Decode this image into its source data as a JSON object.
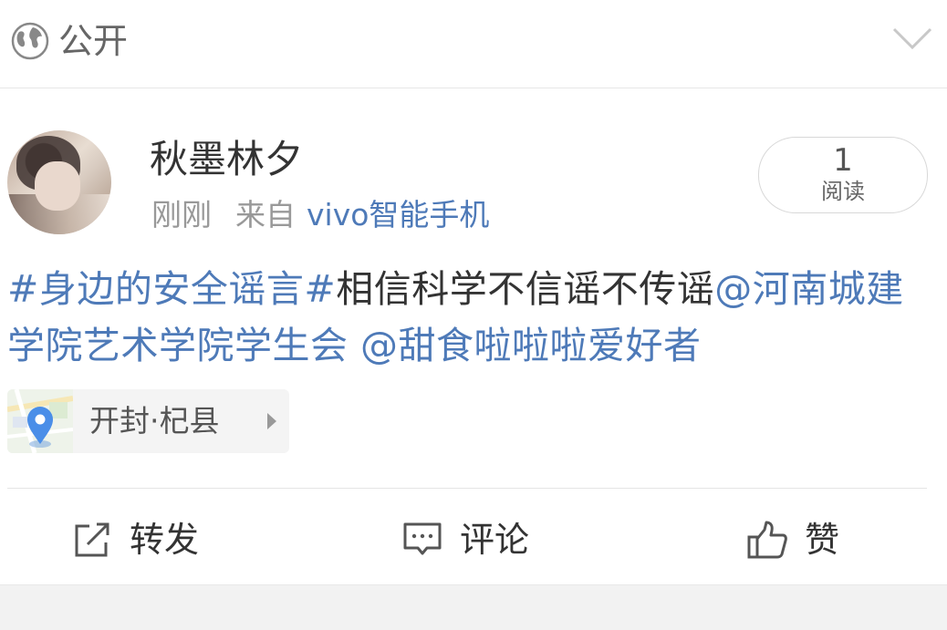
{
  "header": {
    "privacy_label": "公开",
    "globe_icon": "globe-icon",
    "expand_icon": "chevron-down-icon"
  },
  "post": {
    "author": "秋墨林夕",
    "time": "刚刚",
    "from_label": "来自",
    "device": "vivo智能手机",
    "read_count": "1",
    "read_label": "阅读",
    "topic": "#身边的安全谣言#",
    "body_text": "相信科学不信谣不传谣",
    "mention1": "@河南城建学院艺术学院学生会",
    "mention2": "@甜食啦啦啦爱好者",
    "location": "开封·杞县"
  },
  "actions": {
    "repost_label": "转发",
    "comment_label": "评论",
    "like_label": "赞"
  },
  "colors": {
    "link": "#4e7ab8",
    "text": "#333333",
    "muted": "#999999"
  }
}
